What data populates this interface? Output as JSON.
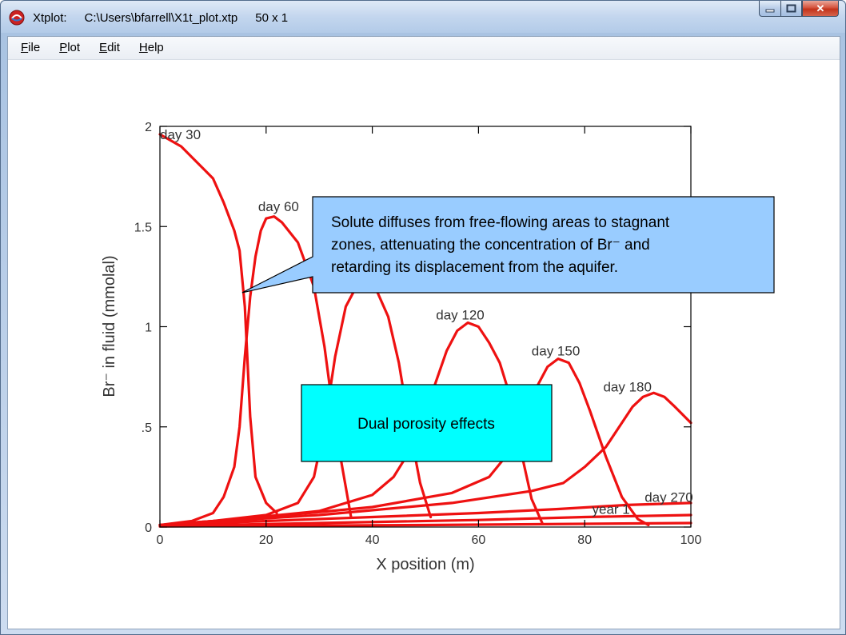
{
  "window": {
    "app_name": "Xtplot:",
    "file_path": "C:\\Users\\bfarrell\\X1t_plot.xtp",
    "grid_size": "50 x 1",
    "controls": {
      "close": "✕"
    }
  },
  "menu": [
    {
      "label": "File"
    },
    {
      "label": "Plot"
    },
    {
      "label": "Edit"
    },
    {
      "label": "Help"
    }
  ],
  "chart_data": {
    "type": "line",
    "xlabel": "X position (m)",
    "ylabel": "Br⁻ in fluid (mmolal)",
    "xlim": [
      0,
      100
    ],
    "ylim": [
      0,
      2
    ],
    "xticks": [
      {
        "v": 0,
        "label": "0"
      },
      {
        "v": 20,
        "label": "20"
      },
      {
        "v": 40,
        "label": "40"
      },
      {
        "v": 60,
        "label": "60"
      },
      {
        "v": 80,
        "label": "80"
      },
      {
        "v": 100,
        "label": "100"
      }
    ],
    "yticks": [
      {
        "v": 0,
        "label": "0"
      },
      {
        "v": 0.5,
        "label": ".5"
      },
      {
        "v": 1,
        "label": "1"
      },
      {
        "v": 1.5,
        "label": "1.5"
      },
      {
        "v": 2,
        "label": "2"
      }
    ],
    "line_color": "#ee1111",
    "series": [
      {
        "name": "day 30",
        "label_at": [
          0,
          1.96
        ],
        "points": [
          [
            0,
            1.96
          ],
          [
            4,
            1.9
          ],
          [
            7,
            1.82
          ],
          [
            10,
            1.74
          ],
          [
            12,
            1.62
          ],
          [
            14,
            1.48
          ],
          [
            15,
            1.38
          ],
          [
            16,
            1.1
          ],
          [
            17,
            0.55
          ],
          [
            18,
            0.25
          ],
          [
            20,
            0.12
          ],
          [
            22,
            0.07
          ]
        ]
      },
      {
        "name": "day 60",
        "label_at": [
          18.5,
          1.6
        ],
        "points": [
          [
            0,
            0.01
          ],
          [
            6,
            0.03
          ],
          [
            10,
            0.07
          ],
          [
            12,
            0.15
          ],
          [
            14,
            0.3
          ],
          [
            15,
            0.5
          ],
          [
            16,
            0.85
          ],
          [
            17,
            1.15
          ],
          [
            18,
            1.35
          ],
          [
            19,
            1.48
          ],
          [
            20,
            1.54
          ],
          [
            21.5,
            1.55
          ],
          [
            23,
            1.52
          ],
          [
            26,
            1.42
          ],
          [
            29,
            1.2
          ],
          [
            31,
            0.9
          ],
          [
            33,
            0.5
          ],
          [
            35,
            0.2
          ],
          [
            36,
            0.05
          ]
        ]
      },
      {
        "name": "",
        "label_at": null,
        "points": [
          [
            0,
            0.01
          ],
          [
            10,
            0.03
          ],
          [
            20,
            0.06
          ],
          [
            26,
            0.12
          ],
          [
            29,
            0.25
          ],
          [
            31,
            0.5
          ],
          [
            33,
            0.85
          ],
          [
            35,
            1.1
          ],
          [
            37,
            1.2
          ],
          [
            39,
            1.22
          ],
          [
            41,
            1.17
          ],
          [
            43,
            1.05
          ],
          [
            45,
            0.82
          ],
          [
            47,
            0.5
          ],
          [
            49,
            0.22
          ],
          [
            51,
            0.05
          ]
        ]
      },
      {
        "name": "day 120",
        "label_at": [
          52,
          1.06
        ],
        "points": [
          [
            0,
            0.01
          ],
          [
            15,
            0.04
          ],
          [
            30,
            0.08
          ],
          [
            40,
            0.16
          ],
          [
            44,
            0.25
          ],
          [
            48,
            0.42
          ],
          [
            51,
            0.65
          ],
          [
            54,
            0.88
          ],
          [
            56,
            0.98
          ],
          [
            58,
            1.02
          ],
          [
            60,
            1.0
          ],
          [
            62,
            0.92
          ],
          [
            64,
            0.82
          ],
          [
            66,
            0.65
          ],
          [
            68,
            0.38
          ],
          [
            70,
            0.14
          ],
          [
            72,
            0.02
          ]
        ]
      },
      {
        "name": "day 150",
        "label_at": [
          70,
          0.88
        ],
        "points": [
          [
            0,
            0.01
          ],
          [
            20,
            0.05
          ],
          [
            40,
            0.1
          ],
          [
            55,
            0.17
          ],
          [
            62,
            0.25
          ],
          [
            66,
            0.38
          ],
          [
            69,
            0.55
          ],
          [
            71,
            0.7
          ],
          [
            73,
            0.8
          ],
          [
            75,
            0.84
          ],
          [
            77,
            0.82
          ],
          [
            79,
            0.72
          ],
          [
            81,
            0.58
          ],
          [
            84,
            0.35
          ],
          [
            87,
            0.15
          ],
          [
            90,
            0.04
          ],
          [
            92,
            0.01
          ]
        ]
      },
      {
        "name": "day 180",
        "label_at": [
          83.5,
          0.7
        ],
        "points": [
          [
            0,
            0.01
          ],
          [
            30,
            0.06
          ],
          [
            55,
            0.12
          ],
          [
            70,
            0.18
          ],
          [
            76,
            0.22
          ],
          [
            80,
            0.3
          ],
          [
            84,
            0.4
          ],
          [
            87,
            0.52
          ],
          [
            89,
            0.6
          ],
          [
            91,
            0.65
          ],
          [
            93,
            0.67
          ],
          [
            95,
            0.65
          ],
          [
            97,
            0.6
          ],
          [
            100,
            0.52
          ]
        ]
      },
      {
        "name": "day 270",
        "label_at": [
          91.3,
          0.15
        ],
        "points": [
          [
            0,
            0.01
          ],
          [
            20,
            0.03
          ],
          [
            40,
            0.05
          ],
          [
            60,
            0.07
          ],
          [
            75,
            0.09
          ],
          [
            88,
            0.11
          ],
          [
            100,
            0.12
          ]
        ]
      },
      {
        "name": "year 1",
        "label_at": [
          81.4,
          0.09
        ],
        "points": [
          [
            0,
            0.005
          ],
          [
            30,
            0.02
          ],
          [
            60,
            0.035
          ],
          [
            80,
            0.05
          ],
          [
            100,
            0.06
          ]
        ]
      },
      {
        "name": "",
        "label_at": null,
        "points": [
          [
            0,
            0.003
          ],
          [
            50,
            0.01
          ],
          [
            100,
            0.02
          ]
        ]
      }
    ],
    "annotations": {
      "callout": "Solute diffuses from free-flowing areas to stagnant zones, attenuating the concentration of Br⁻ and retarding its displacement from the aquifer.",
      "callout_lines": [
        "Solute diffuses from free-flowing areas to stagnant",
        "zones, attenuating the concentration of Br⁻ and",
        "retarding its displacement from the aquifer."
      ],
      "callout_color": "#99ccff",
      "callout_pointer_at": [
        15.5,
        1.17
      ],
      "box": "Dual porosity effects",
      "box_color": "#00ffff"
    }
  }
}
